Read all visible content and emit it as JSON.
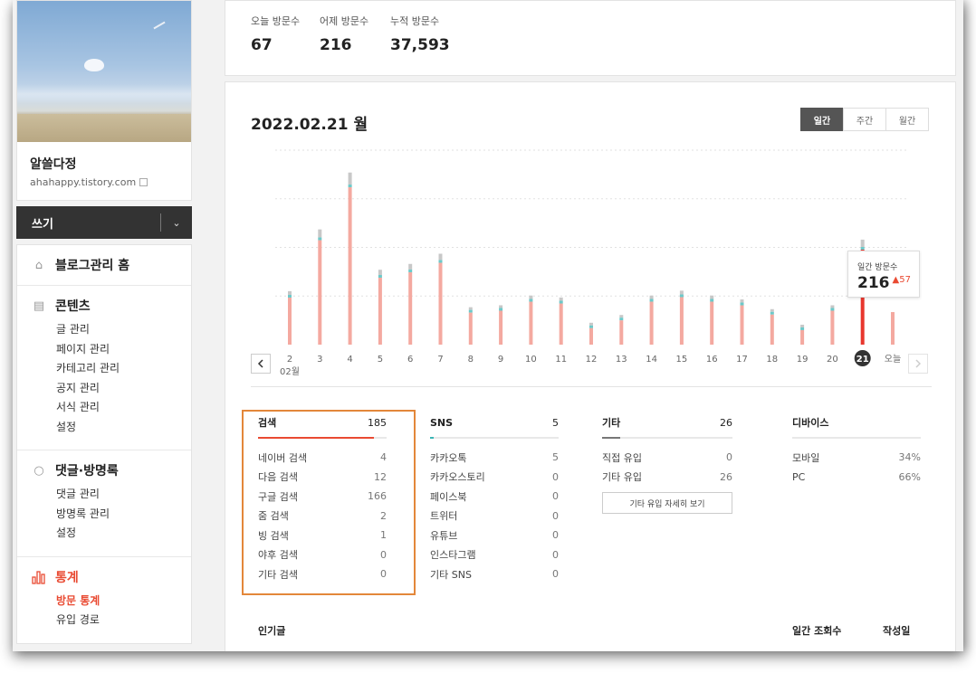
{
  "sidebar": {
    "blog_name": "알쓸다정",
    "blog_url": "ahahappy.tistory.com",
    "write_label": "쓰기",
    "home_label": "블로그관리 홈",
    "sections": {
      "contents": {
        "title": "콘텐츠",
        "items": [
          "글 관리",
          "페이지 관리",
          "카테고리 관리",
          "공지 관리",
          "서식 관리",
          "설정"
        ]
      },
      "comments": {
        "title": "댓글·방명록",
        "items": [
          "댓글 관리",
          "방명록 관리",
          "설정"
        ]
      },
      "stats": {
        "title": "통계",
        "items": [
          "방문 통계",
          "유입 경로"
        ]
      }
    }
  },
  "visitors": {
    "today_label": "오늘 방문수",
    "today_value": "67",
    "yesterday_label": "어제 방문수",
    "yesterday_value": "216",
    "total_label": "누적 방문수",
    "total_value": "37,593"
  },
  "stats": {
    "date_title": "2022.02.21 월",
    "tabs": [
      "일간",
      "주간",
      "월간"
    ],
    "active_tab": "일간",
    "tooltip": {
      "label": "일간 방문수",
      "value": "216",
      "delta": "57"
    }
  },
  "chart_data": {
    "type": "bar",
    "categories": [
      "2",
      "3",
      "4",
      "5",
      "6",
      "7",
      "8",
      "9",
      "10",
      "11",
      "12",
      "13",
      "14",
      "15",
      "16",
      "17",
      "18",
      "19",
      "20",
      "21",
      "오늘"
    ],
    "month_label": "02월",
    "selected_index": 19,
    "series": [
      {
        "values": [
          110,
          237,
          354,
          154,
          166,
          187,
          77,
          81,
          101,
          97,
          45,
          61,
          101,
          111,
          101,
          93,
          73,
          41,
          81,
          216,
          67
        ]
      }
    ],
    "ylim": [
      0,
      400
    ],
    "grid": true,
    "colors": {
      "bar": "#f4a9a0",
      "selected": "#e8372e",
      "cap_cyan": "#6cc9c9",
      "cap_gray": "#c8c8c8"
    }
  },
  "referrers": {
    "search": {
      "title": "검색",
      "total": "185",
      "color": "#e94a32",
      "fraction": 0.9,
      "rows": [
        [
          "네이버 검색",
          "4"
        ],
        [
          "다음 검색",
          "12"
        ],
        [
          "구글 검색",
          "166"
        ],
        [
          "줌 검색",
          "2"
        ],
        [
          "빙 검색",
          "1"
        ],
        [
          "야후 검색",
          "0"
        ],
        [
          "기타 검색",
          "0"
        ]
      ]
    },
    "sns": {
      "title": "SNS",
      "total": "5",
      "color": "#3ab5b5",
      "fraction": 0.03,
      "rows": [
        [
          "카카오톡",
          "5"
        ],
        [
          "카카오스토리",
          "0"
        ],
        [
          "페이스북",
          "0"
        ],
        [
          "트위터",
          "0"
        ],
        [
          "유튜브",
          "0"
        ],
        [
          "인스타그램",
          "0"
        ],
        [
          "기타 SNS",
          "0"
        ]
      ]
    },
    "etc": {
      "title": "기타",
      "total": "26",
      "color": "#777777",
      "fraction": 0.14,
      "rows": [
        [
          "직접 유입",
          "0"
        ],
        [
          "기타 유입",
          "26"
        ]
      ],
      "detail_button": "기타 유입 자세히 보기"
    },
    "device": {
      "title": "디바이스",
      "total": "",
      "color": "#e8e8e8",
      "fraction": 0,
      "rows": [
        [
          "모바일",
          "34%"
        ],
        [
          "PC",
          "66%"
        ]
      ]
    }
  },
  "popular": {
    "title": "인기글",
    "views_label": "일간 조회수",
    "date_label": "작성일"
  }
}
